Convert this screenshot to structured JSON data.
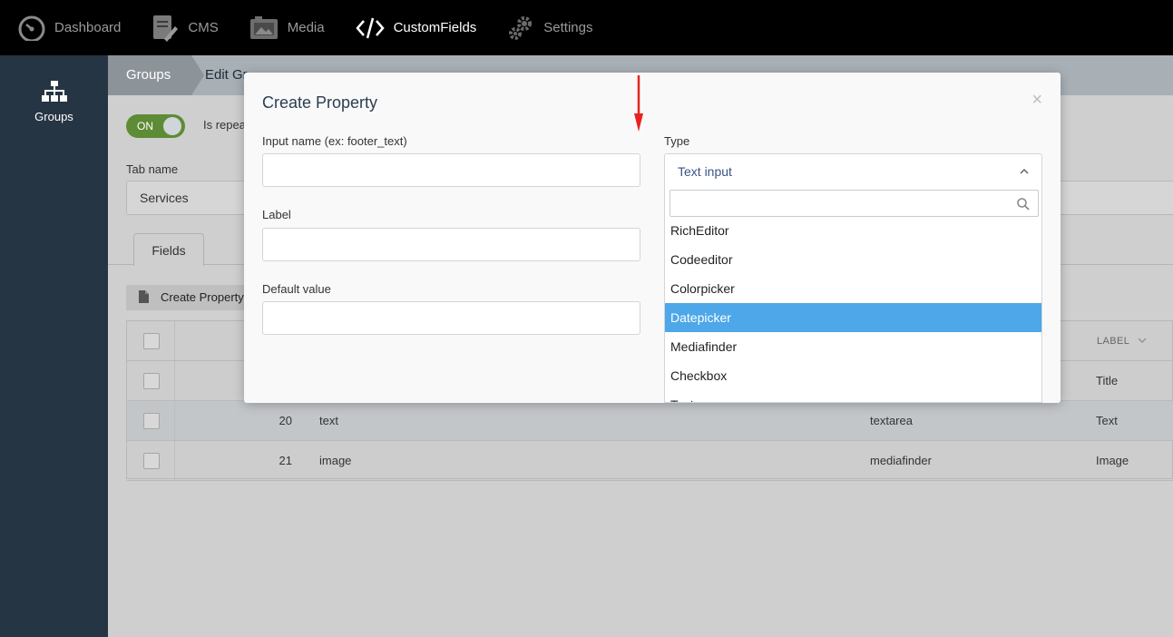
{
  "nav": {
    "items": [
      {
        "label": "Dashboard",
        "icon": "dashboard-icon"
      },
      {
        "label": "CMS",
        "icon": "cms-icon"
      },
      {
        "label": "Media",
        "icon": "media-icon"
      },
      {
        "label": "CustomFields",
        "icon": "code-icon"
      },
      {
        "label": "Settings",
        "icon": "gear-icon"
      }
    ],
    "active": "CustomFields"
  },
  "sidebar": {
    "items": [
      {
        "label": "Groups",
        "icon": "sitemap-icon"
      }
    ]
  },
  "breadcrumb": {
    "items": [
      "Groups",
      "Edit Gr"
    ]
  },
  "form": {
    "toggle_label": "ON",
    "repeat_label": "Is repea",
    "tab_name_label": "Tab name",
    "tab_name_value": "Services",
    "tabs": [
      "Fields"
    ],
    "create_button": "Create Property"
  },
  "table": {
    "header_label": "LABEL",
    "rows": [
      {
        "id": "",
        "name": "",
        "type": "",
        "label": "Title"
      },
      {
        "id": "20",
        "name": "text",
        "type": "textarea",
        "label": "Text"
      },
      {
        "id": "21",
        "name": "image",
        "type": "mediafinder",
        "label": "Image"
      }
    ]
  },
  "modal": {
    "title": "Create Property",
    "close": "×",
    "input_name_label": "Input name (ex: footer_text)",
    "label_label": "Label",
    "default_value_label": "Default value",
    "type_label": "Type",
    "type_selected": "Text input",
    "options": [
      "RichEditor",
      "Codeeditor",
      "Colorpicker",
      "Datepicker",
      "Mediafinder",
      "Checkbox",
      "Text"
    ],
    "highlighted_option": "Datepicker"
  },
  "colors": {
    "topnav_bg": "#000000",
    "sidebar_bg": "#263543",
    "toggle_on": "#5e8b36",
    "option_highlight": "#4da7e8",
    "annotation_arrow": "#e8231f"
  }
}
